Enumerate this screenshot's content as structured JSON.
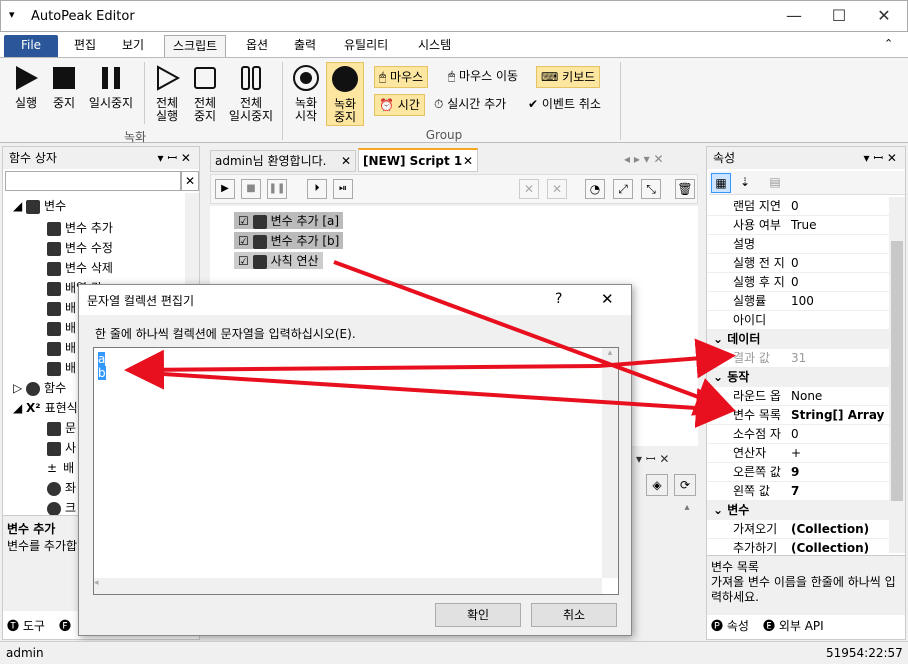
{
  "window": {
    "title": "AutoPeak Editor",
    "menu_icon": "▾",
    "min": "—",
    "max": "☐",
    "close": "✕"
  },
  "tabs": [
    "File",
    "편집",
    "보기",
    "스크립트",
    "옵션",
    "출력",
    "유틸리티",
    "시스템"
  ],
  "ribbon": {
    "rec_buttons": [
      {
        "label": "실행",
        "icon": "play-icon"
      },
      {
        "label": "중지",
        "icon": "stop-icon"
      },
      {
        "label": "일시중지",
        "icon": "pause-icon"
      }
    ],
    "all_buttons": [
      {
        "label": "전체\n실행"
      },
      {
        "label": "전체\n중지"
      },
      {
        "label": "전체\n일시중지"
      }
    ],
    "group1": "녹화",
    "rec2": [
      {
        "label": "녹화\n시작"
      },
      {
        "label": "녹화\n중지"
      }
    ],
    "small": {
      "mouse": "마우스",
      "mouse_move": "마우스 이동",
      "keyboard": "키보드",
      "time": "시간",
      "realtime": "실시간 추가",
      "event_cancel": "이벤트 취소"
    },
    "group2": "Group"
  },
  "left_panel": {
    "title": "함수 상자",
    "tree": {
      "variables": "변수",
      "add": "변수 추가",
      "edit": "변수 수정",
      "delete": "변수 삭제",
      "arr1": "배열 값",
      "arr2": "배",
      "arr3": "배",
      "arr4": "배",
      "arr5": "배",
      "func": "함수",
      "expr": "표현식",
      "e1": "문",
      "e2": "사",
      "e3": "배",
      "e4": "좌",
      "e5": "크"
    },
    "desc_title": "변수 추가",
    "desc": "변수를 추가합",
    "bottom_tabs": [
      "도구",
      "F"
    ]
  },
  "doc_tabs": [
    {
      "label": "admin님 환영합니다."
    },
    {
      "label": "[NEW] Script 1"
    }
  ],
  "script_items": [
    "변수 추가 [a]",
    "변수 추가 [b]",
    "사칙 연산"
  ],
  "props": {
    "title": "속성",
    "rows": [
      {
        "k": "랜덤 지연",
        "v": "0"
      },
      {
        "k": "사용 여부",
        "v": "True"
      },
      {
        "k": "설명",
        "v": ""
      },
      {
        "k": "실행 전 지",
        "v": "0"
      },
      {
        "k": "실행 후 지",
        "v": "0"
      },
      {
        "k": "실행률",
        "v": "100"
      },
      {
        "k": "아이디",
        "v": ""
      }
    ],
    "cat_data": "데이터",
    "result": {
      "k": "결과 값",
      "v": "31"
    },
    "cat_action": "동작",
    "rows2": [
      {
        "k": "라운드 옵",
        "v": "None"
      },
      {
        "k": "변수 목록",
        "v": "String[] Array"
      },
      {
        "k": "소수점 자",
        "v": "0"
      },
      {
        "k": "연산자",
        "v": "+"
      },
      {
        "k": "오른쪽 값",
        "v": "9"
      },
      {
        "k": "왼쪽 값",
        "v": "7"
      }
    ],
    "cat_var": "변수",
    "rows3": [
      {
        "k": "가져오기",
        "v": "(Collection)"
      },
      {
        "k": "추가하기",
        "v": "(Collection)"
      }
    ],
    "desc_title": "변수 목록",
    "desc": "가져올 변수 이름을 한줄에 하나씩 입력하세요.",
    "bottom_tabs": [
      "속성",
      "외부 API"
    ]
  },
  "dialog": {
    "title": "문자열 컬렉션 편집기",
    "help": "?",
    "close": "✕",
    "instruction": "한 줄에 하나씩 컬렉션에 문자열을 입력하십시오(E).",
    "lines": [
      "a",
      "b"
    ],
    "ok": "확인",
    "cancel": "취소"
  },
  "status": {
    "user": "admin",
    "time": "51954:22:57"
  },
  "colors": {
    "file_tab": "#2b579a",
    "highlight": "#fde6a0",
    "arrow": "#e8101e",
    "select": "#3399ff"
  }
}
